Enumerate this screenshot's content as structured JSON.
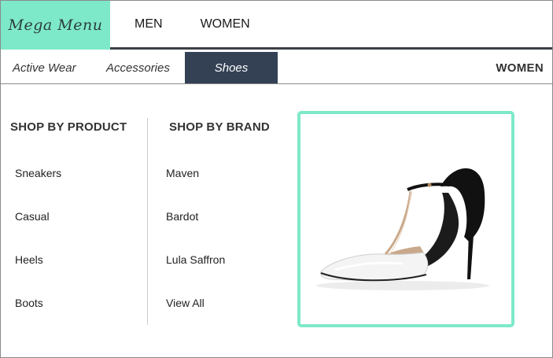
{
  "brand": {
    "logo_text": "Mega Menu",
    "accent_color": "#7ee9c9"
  },
  "topnav": {
    "items": [
      {
        "label": "MEN"
      },
      {
        "label": "WOMEN"
      }
    ]
  },
  "subnav": {
    "tabs": [
      {
        "label": "Active Wear",
        "active": false
      },
      {
        "label": "Accessories",
        "active": false
      },
      {
        "label": "Shoes",
        "active": true
      }
    ],
    "section_label": "WOMEN",
    "active_color": "#344155"
  },
  "mega": {
    "product": {
      "heading": "SHOP BY PRODUCT",
      "items": [
        {
          "label": "Sneakers"
        },
        {
          "label": "Casual"
        },
        {
          "label": "Heels"
        },
        {
          "label": "Boots"
        }
      ]
    },
    "brand": {
      "heading": "SHOP BY BRAND",
      "items": [
        {
          "label": "Maven"
        },
        {
          "label": "Bardot"
        },
        {
          "label": "Lula Saffron"
        },
        {
          "label": "View All"
        }
      ]
    },
    "feature_image": {
      "icon": "white-black-t-strap-heel-image"
    }
  }
}
